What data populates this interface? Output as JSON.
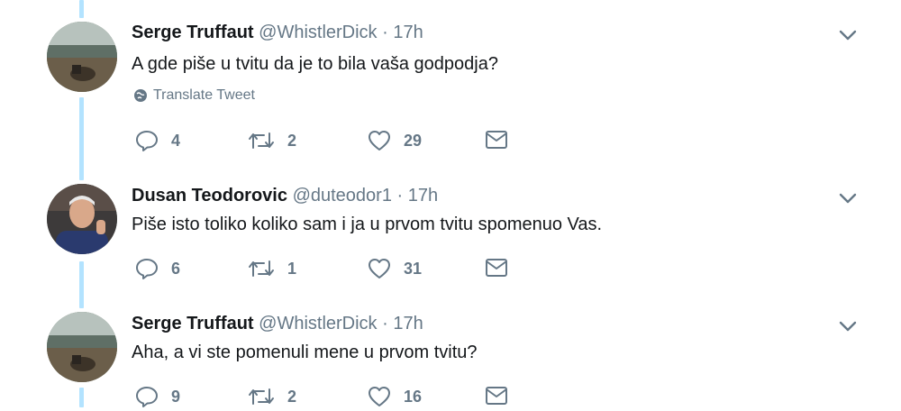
{
  "tweets": [
    {
      "name": "Serge Truffaut",
      "handle": "@WhistlerDick",
      "dot": "·",
      "time": "17h",
      "text": "A gde piše u tvitu da je to bila vaša godpodja?",
      "translate": "Translate Tweet",
      "replies": "4",
      "retweets": "2",
      "likes": "29"
    },
    {
      "name": "Dusan Teodorovic",
      "handle": "@duteodor1",
      "dot": "·",
      "time": "17h",
      "text": "Piše isto toliko koliko sam i ja u prvom tvitu spomenuo Vas.",
      "replies": "6",
      "retweets": "1",
      "likes": "31"
    },
    {
      "name": "Serge Truffaut",
      "handle": "@WhistlerDick",
      "dot": "·",
      "time": "17h",
      "text": "Aha, a vi ste pomenuli mene u prvom tvitu?",
      "replies": "9",
      "retweets": "2",
      "likes": "16"
    }
  ],
  "colors": {
    "thread_line": "#b3e3ff",
    "secondary_text": "#657786",
    "primary_text": "#14171a"
  },
  "icons": [
    "globe-icon",
    "chevron-down-icon",
    "reply-icon",
    "retweet-icon",
    "like-icon",
    "direct-message-icon"
  ]
}
